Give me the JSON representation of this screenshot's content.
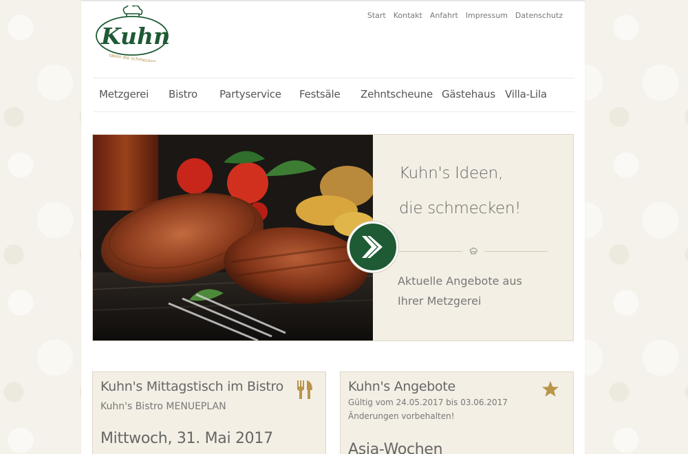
{
  "brand": {
    "logo_text": "Kuhn's",
    "logo_tagline": "Ideen die schmecken"
  },
  "topnav": [
    "Start",
    "Kontakt",
    "Anfahrt",
    "Impressum",
    "Datenschutz"
  ],
  "mainnav": [
    "Metzgerei",
    "Bistro",
    "Partyservice",
    "Festsäle",
    "Zehntscheune",
    "Gästehaus",
    "Villa-Lila"
  ],
  "hero": {
    "headline_1": "Kuhn's Ideen,",
    "headline_2": "die schmecken!",
    "subline_1": "Aktuelle Angebote aus",
    "subline_2": "Ihrer Metzgerei",
    "image_icon": "grilled-steak-photo",
    "button_icon": "arrow-right-icon"
  },
  "cards": {
    "bistro": {
      "title": "Kuhn's Mittagstisch im Bistro",
      "subtitle": "Kuhn's Bistro MENUEPLAN",
      "date": "Mittwoch, 31. Mai 2017",
      "icon": "fork-knife-icon"
    },
    "angebote": {
      "title": "Kuhn's Angebote",
      "valid": "Gültig vom 24.05.2017 bis 03.06.2017",
      "note": "Änderungen vorbehalten!",
      "heading": "Asia-Wochen",
      "icon": "star-icon"
    }
  },
  "colors": {
    "brand_green": "#1e5a34",
    "accent_gold": "#b8954a",
    "panel_beige": "#f4efe5"
  }
}
